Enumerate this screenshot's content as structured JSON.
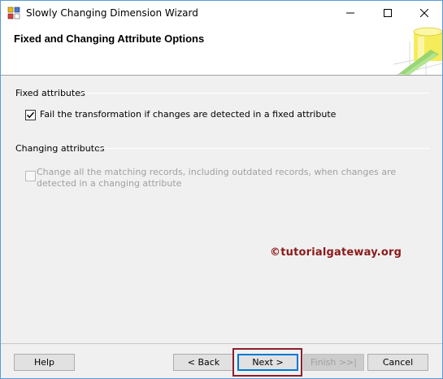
{
  "window": {
    "title": "Slowly Changing Dimension Wizard",
    "icon": "ssis-wizard-icon"
  },
  "header": {
    "title": "Fixed and Changing Attribute Options"
  },
  "fixed_section": {
    "label": "Fixed attributes",
    "checkbox_label": "Fail the transformation if changes are detected in a fixed attribute",
    "checked": true
  },
  "changing_section": {
    "label": "Changing attributes",
    "checkbox_label": "Change all the matching records, including outdated records, when changes are detected in a changing attribute",
    "checked": false,
    "enabled": false
  },
  "watermark": "©tutorialgateway.org",
  "buttons": {
    "help": "Help",
    "back": "< Back",
    "next": "Next >",
    "finish": "Finish >>|",
    "cancel": "Cancel"
  },
  "colors": {
    "accent": "#0078d7",
    "highlight_box": "#8b1f2d",
    "watermark": "#8b1a1a"
  }
}
